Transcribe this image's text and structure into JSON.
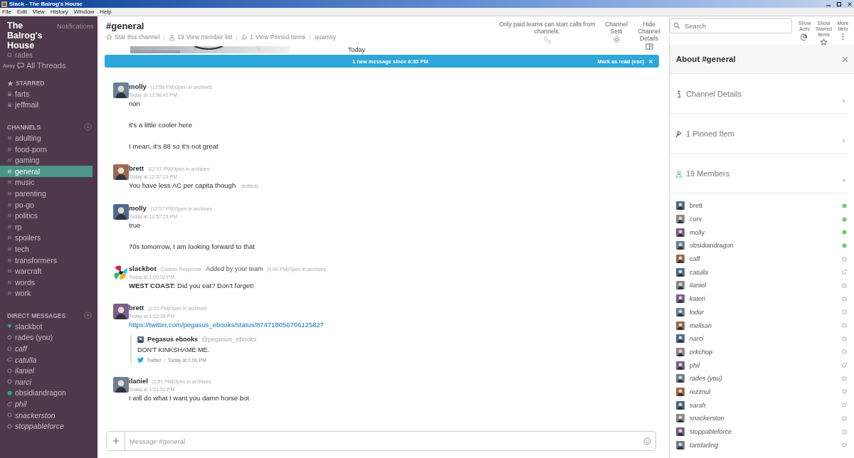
{
  "window": {
    "title": "Slack - The Balrog's House"
  },
  "menu": [
    "File",
    "Edit",
    "View",
    "History",
    "Window",
    "Help"
  ],
  "sidebar": {
    "team": "The Balrog's House",
    "notifications": "Notifications",
    "user": {
      "name": "rades",
      "online": false,
      "snoozed": false
    },
    "away_label": "Away",
    "all_threads": "All Threads",
    "starred": {
      "title": "STARRED",
      "items": [
        {
          "name": "farts",
          "selected": false
        },
        {
          "name": "jeffmail",
          "selected": false
        }
      ]
    },
    "channels": {
      "title": "CHANNELS",
      "items": [
        {
          "name": "adulting",
          "selected": false
        },
        {
          "name": "food-porn",
          "selected": false
        },
        {
          "name": "gaming",
          "selected": false
        },
        {
          "name": "general",
          "selected": true
        },
        {
          "name": "music",
          "selected": false
        },
        {
          "name": "parenting",
          "selected": false
        },
        {
          "name": "po-go",
          "selected": false
        },
        {
          "name": "politics",
          "selected": false
        },
        {
          "name": "rp",
          "selected": false
        },
        {
          "name": "spoilers",
          "selected": false
        },
        {
          "name": "tech",
          "selected": false
        },
        {
          "name": "transformers",
          "selected": false
        },
        {
          "name": "warcraft",
          "selected": false
        },
        {
          "name": "words",
          "selected": false
        },
        {
          "name": "work",
          "selected": false
        }
      ]
    },
    "direct_messages": {
      "title": "DIRECT MESSAGES",
      "items": [
        {
          "name": "slackbot",
          "kind": "bot",
          "selected": false
        },
        {
          "name": "rades (you)",
          "kind": "self",
          "online": false,
          "snoozed": false,
          "selected": false
        },
        {
          "name": "caff",
          "kind": "user",
          "online": false,
          "snoozed": false,
          "selected": false
        },
        {
          "name": "catulla",
          "kind": "user",
          "online": false,
          "snoozed": true,
          "selected": false
        },
        {
          "name": "ilaniel",
          "kind": "user",
          "online": false,
          "snoozed": false,
          "selected": false
        },
        {
          "name": "narci",
          "kind": "user",
          "online": false,
          "snoozed": false,
          "selected": false
        },
        {
          "name": "obsidiandragon",
          "kind": "user",
          "online": true,
          "snoozed": false,
          "selected": false
        },
        {
          "name": "phil",
          "kind": "user",
          "online": false,
          "snoozed": true,
          "selected": false
        },
        {
          "name": "snackerston",
          "kind": "user",
          "online": false,
          "snoozed": false,
          "selected": false
        },
        {
          "name": "stoppableforce",
          "kind": "user",
          "online": false,
          "snoozed": false,
          "selected": false
        }
      ]
    }
  },
  "channel_header": {
    "name": "#general",
    "star": "Star this channel",
    "member_count": "19",
    "member_link": "View member list",
    "pinned_count": "1",
    "pinned_link": "View Pinned Items",
    "topic": "quamsy"
  },
  "header_tools": [
    {
      "kind": "calls",
      "label": "Only paid teams can start calls from channels."
    },
    {
      "kind": "settings",
      "label": "Channel Setti"
    },
    {
      "kind": "details",
      "label": "Hide Channel Details"
    }
  ],
  "top_tools": [
    {
      "kind": "activity",
      "label": "Show Activ"
    },
    {
      "kind": "starred",
      "label": "Show Starred Items"
    },
    {
      "kind": "more",
      "label": "More Item"
    }
  ],
  "search": {
    "placeholder": "Search"
  },
  "day_divider": "Today",
  "banner": {
    "text": "1 new message since 6:35 PM",
    "action": "Mark as read (esc)"
  },
  "messages": [
    {
      "author": "molly",
      "kind": "user",
      "meta": "|12:56 PM|Open in archives",
      "time": "Today at 12:56:42 PM",
      "lines": [
        "non",
        "it's a little cooler here",
        "I mean, it's 88 so it's not great"
      ]
    },
    {
      "author": "brett",
      "kind": "user",
      "meta": "|12:57 PM|Open in archives",
      "time": "Today at 12:57:19 PM",
      "lines": [
        "You have less AC per capita though"
      ],
      "edited": "(edited)"
    },
    {
      "author": "molly",
      "kind": "user",
      "meta": "|12:57 PM|Open in archives",
      "time": "Today at 12:57:23 PM",
      "lines": [
        "true",
        "70s tomorrow, I am looking forward to that"
      ]
    },
    {
      "author": "slackbot",
      "kind": "bot",
      "tag": "Custom Response",
      "note": "Added by your team",
      "meta": "|1:00 PM|Open in archives",
      "time": "Today at 1:00:02 PM",
      "lines": [
        "**WEST COAST:** Did you eat? Don't forget!"
      ]
    },
    {
      "author": "brett",
      "kind": "user",
      "meta": "|1:02 PM|Open in archives",
      "time": "Today at 1:02:36 PM",
      "link": "https://twitter.com/pegasus_ebooks/status/874718056706125827",
      "attachment": {
        "author": "Pegasus ebooks",
        "handle": "@pegasus_ebooks",
        "text": "DON'T KINKSHAME ME.",
        "footer": "Twitter",
        "footer_time": "Today at 1:00 PM"
      }
    },
    {
      "author": "ilaniel",
      "kind": "user",
      "meta": "|1:51 PM|Open in archives",
      "time": "Today at 1:51:52 PM",
      "lines": [
        "I will do what I want you damn horse bot"
      ]
    }
  ],
  "composer": {
    "placeholder": "Message #general"
  },
  "details": {
    "title": "About #general",
    "sections": [
      {
        "kind": "info",
        "label": "Channel Details",
        "expanded": false
      },
      {
        "kind": "pin",
        "label": "1 Pinned Item",
        "expanded": false
      },
      {
        "kind": "members",
        "label": "19 Members",
        "expanded": true
      }
    ],
    "members": [
      {
        "name": "brett",
        "online": true,
        "snoozed": false
      },
      {
        "name": "corv",
        "online": true,
        "snoozed": false
      },
      {
        "name": "molly",
        "online": true,
        "snoozed": false
      },
      {
        "name": "obsidiandragon",
        "online": true,
        "snoozed": false
      },
      {
        "name": "caff",
        "online": false,
        "snoozed": false
      },
      {
        "name": "catulla",
        "online": false,
        "snoozed": true
      },
      {
        "name": "ilaniel",
        "online": false,
        "snoozed": false
      },
      {
        "name": "kateri",
        "online": false,
        "snoozed": false
      },
      {
        "name": "lodur",
        "online": false,
        "snoozed": false
      },
      {
        "name": "melisan",
        "online": false,
        "snoozed": false
      },
      {
        "name": "narci",
        "online": false,
        "snoozed": false
      },
      {
        "name": "orkchop",
        "online": false,
        "snoozed": false
      },
      {
        "name": "phil",
        "online": false,
        "snoozed": true
      },
      {
        "name": "rades (you)",
        "online": false,
        "snoozed": false
      },
      {
        "name": "rezznul",
        "online": false,
        "snoozed": false
      },
      {
        "name": "sarah",
        "online": false,
        "snoozed": true
      },
      {
        "name": "snackerston",
        "online": false,
        "snoozed": false
      },
      {
        "name": "stoppableforce",
        "online": false,
        "snoozed": false
      },
      {
        "name": "tartdarling",
        "online": false,
        "snoozed": false
      }
    ]
  }
}
